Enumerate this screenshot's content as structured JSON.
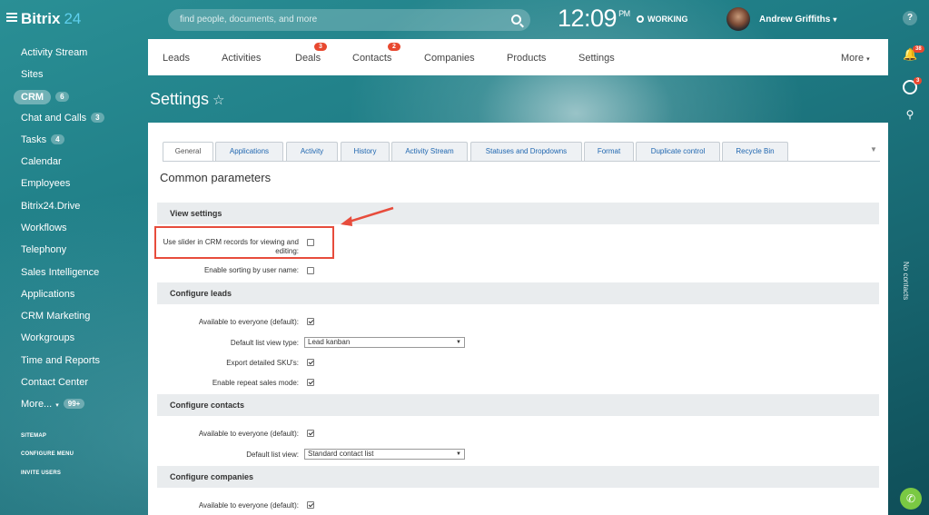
{
  "header": {
    "logo_text": "Bitrix",
    "logo_num": "24",
    "search_placeholder": "find people, documents, and more",
    "clock": "12:09",
    "clock_suffix": "PM",
    "status": "WORKING",
    "user_name": "Andrew Griffiths"
  },
  "sidebar": {
    "items": [
      {
        "label": "Activity Stream"
      },
      {
        "label": "Sites"
      },
      {
        "label": "CRM",
        "badge": "6"
      },
      {
        "label": "Chat and Calls",
        "badge": "3"
      },
      {
        "label": "Tasks",
        "badge": "4"
      },
      {
        "label": "Calendar"
      },
      {
        "label": "Employees"
      },
      {
        "label": "Bitrix24.Drive"
      },
      {
        "label": "Workflows"
      },
      {
        "label": "Telephony"
      },
      {
        "label": "Sales Intelligence"
      },
      {
        "label": "Applications"
      },
      {
        "label": "CRM Marketing"
      },
      {
        "label": "Workgroups"
      },
      {
        "label": "Time and Reports"
      },
      {
        "label": "Contact Center"
      },
      {
        "label": "More...",
        "badge": "99+"
      }
    ],
    "footer": [
      "SITEMAP",
      "CONFIGURE MENU",
      "INVITE USERS"
    ]
  },
  "rightbar": {
    "notif_badge": "38",
    "chat_badge": "3",
    "vertical_text": "No contacts"
  },
  "menu": {
    "items": [
      {
        "label": "Leads"
      },
      {
        "label": "Activities"
      },
      {
        "label": "Deals",
        "badge": "3"
      },
      {
        "label": "Contacts",
        "badge": "2"
      },
      {
        "label": "Companies"
      },
      {
        "label": "Products"
      },
      {
        "label": "Settings"
      }
    ],
    "more": "More"
  },
  "page": {
    "title": "Settings",
    "tabs": [
      "General",
      "Applications",
      "Activity",
      "History",
      "Activity Stream",
      "Statuses and Dropdowns",
      "Format",
      "Duplicate control",
      "Recycle Bin"
    ],
    "heading": "Common parameters",
    "sections": {
      "view": "View settings",
      "leads": "Configure leads",
      "contacts": "Configure contacts",
      "companies": "Configure companies"
    },
    "fields": {
      "slider": "Use slider in CRM records for viewing and editing:",
      "sorting": "Enable sorting by user name:",
      "leads_everyone": "Available to everyone (default):",
      "leads_view_type": "Default list view type:",
      "leads_view_type_value": "Lead kanban",
      "export_sku": "Export detailed SKU's:",
      "repeat_sales": "Enable repeat sales mode:",
      "contacts_everyone": "Available to everyone (default):",
      "contacts_view": "Default list view:",
      "contacts_view_value": "Standard contact list",
      "companies_everyone": "Available to everyone (default):"
    }
  },
  "colors": {
    "accent": "#2067b0",
    "badge": "#e8482f",
    "highlight": "#e74c3c",
    "phone": "#7ac943"
  }
}
